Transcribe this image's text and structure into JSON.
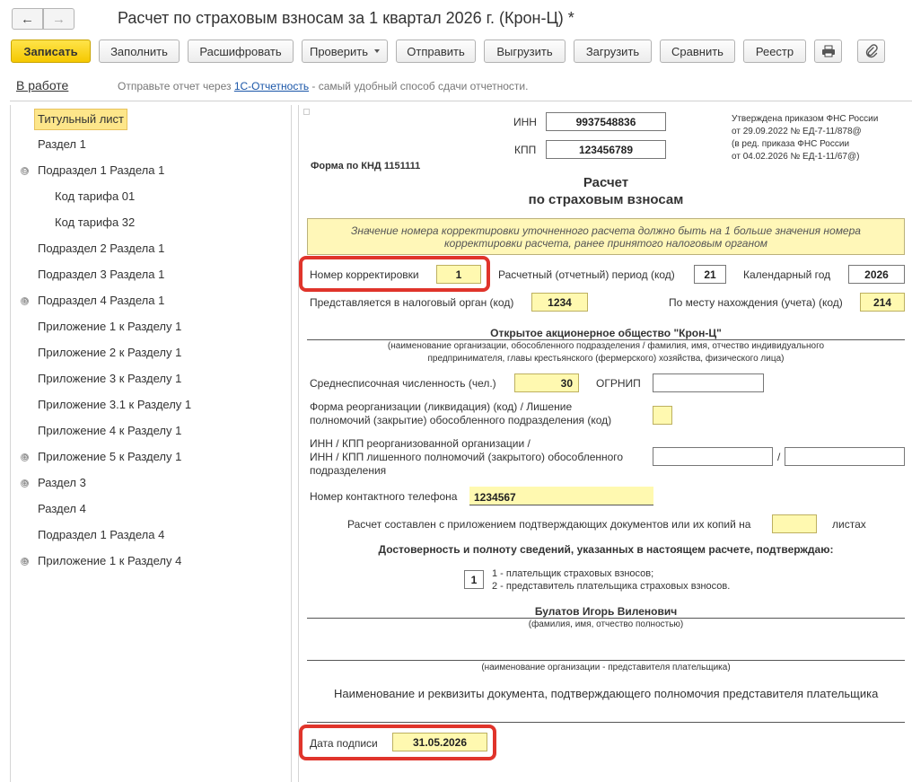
{
  "header": {
    "back_icon": "←",
    "forward_icon": "→",
    "title": "Расчет по страховым взносам за 1 квартал 2026 г. (Крон-Ц) *"
  },
  "toolbar": {
    "save": "Записать",
    "fill": "Заполнить",
    "decode": "Расшифровать",
    "check": "Проверить",
    "send": "Отправить",
    "export": "Выгрузить",
    "import": "Загрузить",
    "compare": "Сравнить",
    "registry": "Реестр"
  },
  "status": {
    "state": "В работе",
    "msg_before": "Отправьте отчет через ",
    "msg_link": "1С-Отчетность",
    "msg_after": " - самый удобный способ сдачи отчетности."
  },
  "tree": [
    {
      "label": "Титульный лист"
    },
    {
      "label": "Раздел 1"
    },
    {
      "label": "Подраздел 1 Раздела 1",
      "expander": "⊖"
    },
    {
      "label": "Код тарифа 01"
    },
    {
      "label": "Код тарифа 32"
    },
    {
      "label": "Подраздел 2 Раздела 1"
    },
    {
      "label": "Подраздел 3 Раздела 1"
    },
    {
      "label": "Подраздел 4 Раздела 1",
      "expander": "⊕"
    },
    {
      "label": "Приложение 1 к Разделу 1"
    },
    {
      "label": "Приложение 2 к Разделу 1"
    },
    {
      "label": "Приложение 3 к Разделу 1"
    },
    {
      "label": "Приложение 3.1 к Разделу 1"
    },
    {
      "label": "Приложение 4 к Разделу 1"
    },
    {
      "label": "Приложение 5 к Разделу 1",
      "expander": "⊕"
    },
    {
      "label": "Раздел 3",
      "expander": "⊕"
    },
    {
      "label": "Раздел 4"
    },
    {
      "label": "Подраздел 1 Раздела 4"
    },
    {
      "label": "Приложение 1 к Разделу 4",
      "expander": "⊕"
    }
  ],
  "form": {
    "inn_label": "ИНН",
    "inn": "9937548836",
    "kpp_label": "КПП",
    "kpp": "123456789",
    "approval_1": "Утверждена приказом ФНС России",
    "approval_2": "от 29.09.2022 № ЕД-7-11/878@",
    "approval_3": "(в ред. приказа ФНС России",
    "approval_4": "от 04.02.2026 № ЕД-1-11/67@)",
    "knd": "Форма по КНД 1151111",
    "heading_1": "Расчет",
    "heading_2": "по страховым взносам",
    "notice_1": "Значение номера корректировки уточненного расчета должно быть на 1 больше значения номера",
    "notice_2": "корректировки расчета, ранее принятого налоговым органом",
    "correction_label": "Номер корректировки",
    "correction": "1",
    "period_label": "Расчетный (отчетный) период (код)",
    "period": "21",
    "year_label": "Календарный год",
    "year": "2026",
    "tax_office_label": "Представляется в налоговый орган (код)",
    "tax_office": "1234",
    "location_label": "По месту нахождения (учета) (код)",
    "location": "214",
    "org_name": "Открытое акционерное общество \"Крон-Ц\"",
    "org_hint_1": "(наименование организации, обособленного подразделения / фамилия, имя, отчество индивидуального",
    "org_hint_2": "предпринимателя, главы крестьянского (фермерского) хозяйства, физического лица)",
    "headcount_label": "Среднесписочная численность (чел.)",
    "headcount": "30",
    "ogrnip_label": "ОГРНИП",
    "ogrnip": "",
    "reorg_label_1": "Форма реорганизации (ликвидация) (код) / Лишение",
    "reorg_label_2": "полномочий (закрытие) обособленного подразделения (код)",
    "reorg": "",
    "reorg_inn_label_1": "ИНН / КПП реорганизованной организации /",
    "reorg_inn_label_2": "ИНН / КПП лишенного полномочий (закрытого) обособленного",
    "reorg_inn_label_3": "подразделения",
    "slash": "/",
    "phone_label": "Номер контактного телефона",
    "phone": "1234567",
    "attach_label": "Расчет составлен с приложением подтверждающих документов или их копий на",
    "attach": "",
    "attach_unit": "листах",
    "confirm": "Достоверность и полноту сведений, указанных в настоящем расчете, подтверждаю:",
    "signer_code": "1",
    "signer_opt_1": "1 - плательщик страховых взносов;",
    "signer_opt_2": "2 - представитель плательщика страховых взносов.",
    "signer_name": "Булатов Игорь Виленович",
    "signer_hint": "(фамилия, имя, отчество полностью)",
    "rep_hint": "(наименование организации - представителя плательщика)",
    "doc_label": "Наименование и реквизиты документа, подтверждающего полномочия представителя плательщика",
    "date_label": "Дата подписи",
    "date": "31.05.2026"
  },
  "colors": {
    "accent_yellow": "#f5c800",
    "field_yellow": "#fff9b0",
    "highlight_red": "#e0342b",
    "link": "#1a56a8"
  }
}
